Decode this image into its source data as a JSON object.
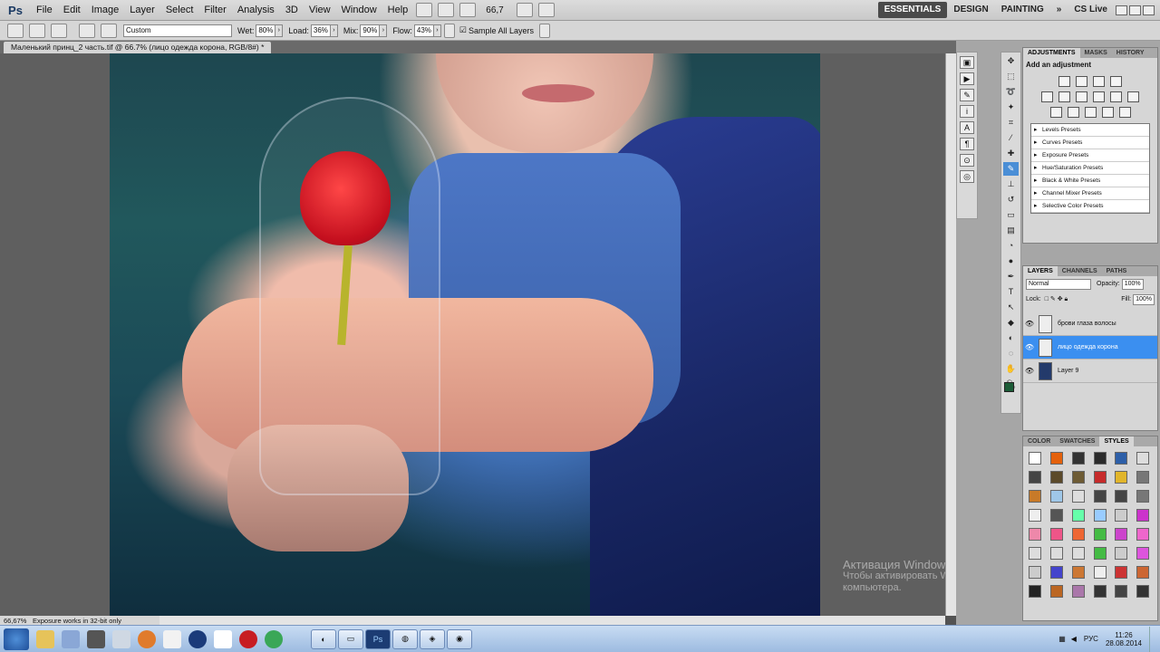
{
  "app": {
    "logo": "Ps"
  },
  "menu": [
    "File",
    "Edit",
    "Image",
    "Layer",
    "Select",
    "Filter",
    "Analysis",
    "3D",
    "View",
    "Window",
    "Help"
  ],
  "zoom_display": "66,7",
  "workspaces": [
    "ESSENTIALS",
    "DESIGN",
    "PAINTING"
  ],
  "cslive": "CS Live",
  "options": {
    "preset": "Custom",
    "wet_label": "Wet:",
    "wet_value": "80%",
    "load_label": "Load:",
    "load_value": "36%",
    "mix_label": "Mix:",
    "mix_value": "90%",
    "flow_label": "Flow:",
    "flow_value": "43%",
    "sample_all": "Sample All Layers"
  },
  "document": {
    "tab_title": "Маленький принц_2 часть.tif @ 66.7% (лицо одежда корона, RGB/8#) *"
  },
  "status": {
    "zoom": "66,67%",
    "info": "Exposure works in 32-bit only"
  },
  "watermark": {
    "title": "Активация Windows",
    "line1": "Чтобы активировать Windows, пер",
    "line2": "компьютера."
  },
  "adjustments": {
    "tabs": [
      "ADJUSTMENTS",
      "MASKS",
      "HISTORY"
    ],
    "title": "Add an adjustment",
    "presets": [
      "Levels Presets",
      "Curves Presets",
      "Exposure Presets",
      "Hue/Saturation Presets",
      "Black & White Presets",
      "Channel Mixer Presets",
      "Selective Color Presets"
    ]
  },
  "layers_panel": {
    "tabs": [
      "LAYERS",
      "CHANNELS",
      "PATHS"
    ],
    "blend_mode": "Normal",
    "opacity_label": "Opacity:",
    "opacity_value": "100%",
    "lock_label": "Lock:",
    "fill_label": "Fill:",
    "fill_value": "100%",
    "layers": [
      {
        "name": "брови глаза волосы",
        "selected": false
      },
      {
        "name": "лицо одежда корона",
        "selected": true
      },
      {
        "name": "Layer 9",
        "selected": false
      }
    ]
  },
  "styles_panel": {
    "tabs": [
      "COLOR",
      "SWATCHES",
      "STYLES"
    ]
  },
  "taskbar": {
    "lang": "РУС",
    "time": "11:26",
    "date": "28.08.2014"
  },
  "colors": {
    "foreground": "#1c5c37",
    "selection": "#3b8ff0",
    "accent": "#4a4a4a"
  }
}
